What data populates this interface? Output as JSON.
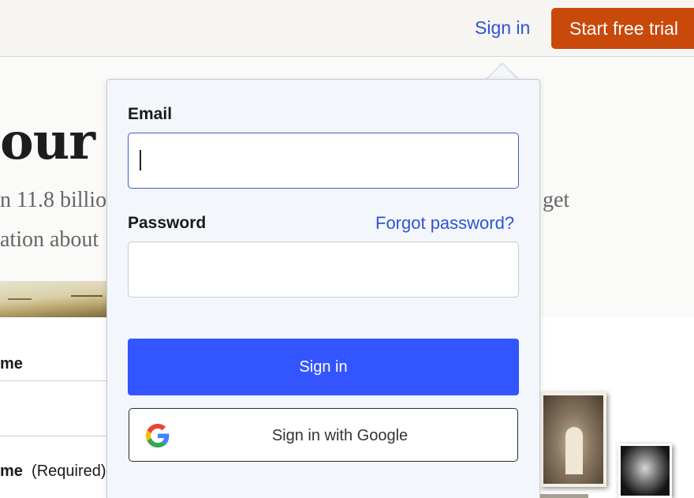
{
  "header": {
    "sign_in_label": "Sign in",
    "trial_button_label": "Start free trial"
  },
  "background": {
    "hero_title": "our f",
    "hero_line_1": "n 11.8 billio",
    "hero_line_1_tail": "get",
    "hero_line_2": "ation about",
    "field_1_label": "me",
    "field_2_label": "me",
    "field_2_required": "(Required)"
  },
  "signin_popover": {
    "email_label": "Email",
    "email_value": "",
    "password_label": "Password",
    "forgot_password_label": "Forgot password?",
    "password_value": "",
    "submit_label": "Sign in",
    "google_label": "Sign in with Google"
  },
  "colors": {
    "accent_link": "#2f52d6",
    "trial_button": "#c9490b",
    "submit_button": "#3355ff",
    "popover_bg": "#f3f7fb"
  },
  "icons": {
    "google": "google-g-icon"
  }
}
